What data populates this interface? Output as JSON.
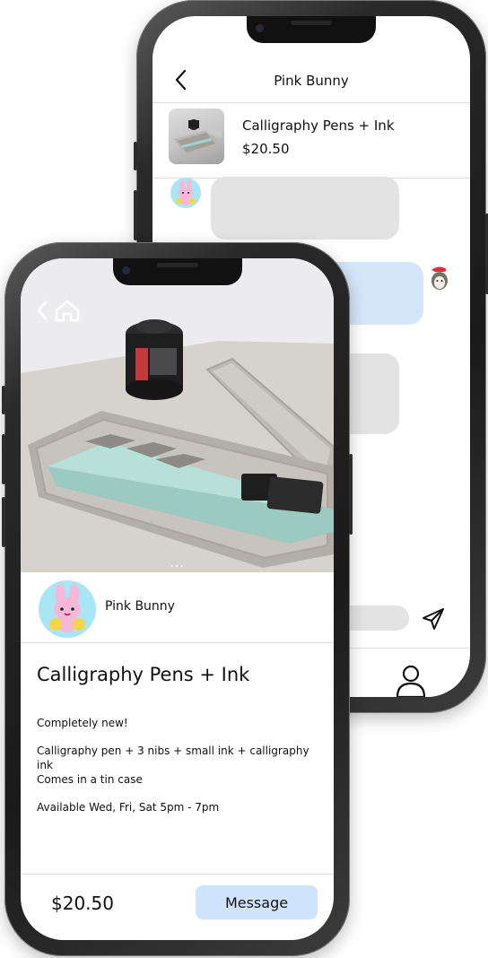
{
  "chat_screen": {
    "header": {
      "title": "Pink Bunny"
    },
    "listing": {
      "title": "Calligraphy Pens + Ink",
      "price": "$20.50"
    }
  },
  "listing_screen": {
    "photo_pagination": "...",
    "seller": {
      "name": "Pink Bunny"
    },
    "title": "Calligraphy Pens + Ink",
    "description": [
      "Completely new!",
      "Calligraphy pen + 3 nibs + small ink + calligraphy ink",
      "Comes in a tin case",
      "Available Wed, Fri, Sat 5pm - 7pm"
    ],
    "footer": {
      "price": "$20.50",
      "message_label": "Message"
    }
  },
  "colors": {
    "bubble_gray": "#e3e3e3",
    "bubble_blue": "#d4e6fa",
    "message_button": "#cfe3fb",
    "avatar_bg": "#a9e6f5"
  },
  "icons": [
    "chevron-left-icon",
    "home-icon",
    "send-icon",
    "person-icon",
    "bunny-avatar-icon"
  ]
}
